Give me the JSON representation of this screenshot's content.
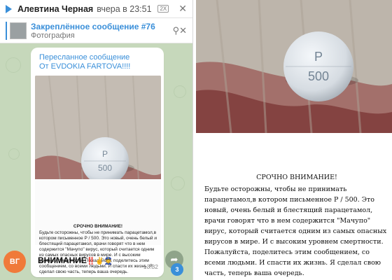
{
  "header": {
    "sender": "Алевтина Черная",
    "time": "вчера в 23:51",
    "pip_label": "2X",
    "close_icon": "close-icon"
  },
  "pinned": {
    "title": "Закреплённое сообщение #76",
    "subtitle": "Фотография"
  },
  "message": {
    "forwarded_line1": "Пересланное сообщение",
    "forwarded_line2": "От EVDOKIA FARTOVA!!!!",
    "pill_text_line1": "P",
    "pill_text_line2": "500",
    "warning_title": "СРОЧНО ВНИМАНИЕ!",
    "warning_body": "Будьте осторожны, чтобы не принимать парацетамол,в котором письменное P / 500. Это новый, очень белый и блестящий парацетамол, врачи говорят что в нем содержится \"Мачупо\" вирус, который считается одним из самых опасных вирусов в мире. И с высоким уровнем смертности. Пожалуйста, поделитесь этим сообщением, со всеми людьми. И спасти их жизнь. Я сделал свою часть, теперь ваша очередь.",
    "caption": "ВНИМАНИЕ",
    "caption_emoji": "‼️✌️👮",
    "time": "13:32",
    "avatar_initials": "ВГ",
    "unread_count": "3"
  },
  "right": {
    "pill_text_line1": "P",
    "pill_text_line2": "500",
    "warning_title": "СРОЧНО ВНИМАНИЕ!",
    "warning_body": "Будьте осторожны, чтобы не принимать парацетамол,в котором письменное P / 500. Это новый, очень белый и блестящий парацетамол, врачи говорят что в нем содержится \"Мачупо\" вирус, который считается одним из самых опасных вирусов в мире. И с высоким уровнем смертности. Пожалуйста, поделитесь этим сообщением, со всеми людьми. И спасти их жизнь. Я сделал свою часть, теперь ваша очередь."
  },
  "colors": {
    "accent": "#3a8fd9",
    "avatar": "#f07a3a",
    "chat_bg": "#c6d8bb"
  }
}
